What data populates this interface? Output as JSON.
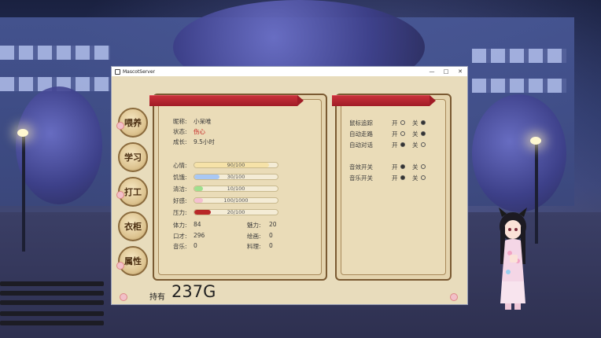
{
  "window": {
    "title": "MascotServer"
  },
  "titlebar_controls": {
    "minimize": "—",
    "maximize": "□",
    "close": "✕"
  },
  "nav": [
    {
      "label": "喂养"
    },
    {
      "label": "学习"
    },
    {
      "label": "打工"
    },
    {
      "label": "衣柜"
    },
    {
      "label": "属性"
    }
  ],
  "profile": {
    "name_label": "昵称:",
    "name": "小呆唯",
    "status_label": "状态:",
    "status": "伤心",
    "growth_label": "成长:",
    "growth": "9.5小时"
  },
  "meters": [
    {
      "label": "心情:",
      "text": "90/100",
      "value": 0.9,
      "color": "#f6e2a8"
    },
    {
      "label": "饥饿:",
      "text": "30/100",
      "value": 0.3,
      "color": "#a9c8f4"
    },
    {
      "label": "清洁:",
      "text": "10/100",
      "value": 0.1,
      "color": "#9ee08e"
    },
    {
      "label": "好感:",
      "text": "100/1000",
      "value": 0.1,
      "color": "#f4c0d0"
    },
    {
      "label": "压力:",
      "text": "20/100",
      "value": 0.2,
      "color": "#b82828"
    }
  ],
  "attributes": {
    "stamina_label": "体力:",
    "stamina": "84",
    "charm_label": "魅力:",
    "charm": "20",
    "eloquence_label": "口才:",
    "eloquence": "296",
    "painting_label": "绘画:",
    "painting": "0",
    "music_label": "音乐:",
    "music": "0",
    "cooking_label": "料理:",
    "cooking": "0"
  },
  "gold": {
    "label": "持有",
    "value": "237G"
  },
  "settings": [
    {
      "label": "鼠标追踪",
      "on_label": "开",
      "off_label": "关",
      "selected": "off"
    },
    {
      "label": "自动走路",
      "on_label": "开",
      "off_label": "关",
      "selected": "off"
    },
    {
      "label": "自动对话",
      "on_label": "开",
      "off_label": "关",
      "selected": "on"
    },
    {
      "label": "音效开关",
      "on_label": "开",
      "off_label": "关",
      "selected": "on"
    },
    {
      "label": "音乐开关",
      "on_label": "开",
      "off_label": "关",
      "selected": "on"
    }
  ],
  "colors": {
    "ribbon": "#b82a32",
    "panel_border": "#7a5a32",
    "status_red": "#c41e1e"
  }
}
